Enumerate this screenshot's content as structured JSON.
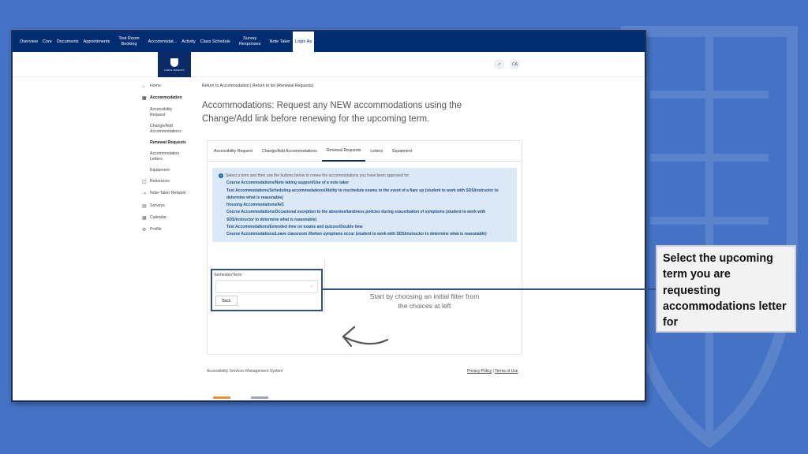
{
  "topnav": {
    "items": [
      "Overview",
      "Core",
      "Documents",
      "Appointments",
      "Test Room\nBooking",
      "Accommodat...",
      "Activity",
      "Class Schedule",
      "Survey\nResponses",
      "Note Taker",
      "Login As"
    ]
  },
  "header": {
    "logo_text": "JOHNS HOPKINS",
    "external_icon": "↗",
    "avatar": "CA"
  },
  "sidebar": {
    "home": "Home",
    "accommodation": "Accommodation",
    "subitems": [
      "Accessibility\nRequest",
      "Change/Add\nAccommodations",
      "Renewal Requests",
      "Accommodation\nLetters",
      "Equipment"
    ],
    "resources": "Resources",
    "note_taker_network": "Note-Taker Network",
    "surveys": "Surveys",
    "calendar": "Calendar",
    "profile": "Profile"
  },
  "main": {
    "breadcrumb": "Return to Accommodation | Return to list (Renewal Requests)",
    "title": "Accommodations: Request any NEW accommodations using the Change/Add link before renewing for the upcoming term.",
    "tabs": [
      "Accessibility Request",
      "Change/Add Accommodations",
      "Renewal Requests",
      "Letters",
      "Equipment"
    ],
    "info_lead": "Select a term and then use the buttons below to renew the accommodations you have been approved for:",
    "info_items": [
      "Course Accommodations/Note taking support/Use of a note taker",
      "Test Accommodations/Scheduling accommodations/Ability to reschedule exams in the event of a flare up (student to work with SDS/instructor to determine what is reasonable)",
      "Housing Accommodations/A/C",
      "Course Accommodations/Occasional exception to the absentee/tardiness policies during exacerbation of symptoms (student to work with SDS/instructor to determine what is reasonable)",
      "Test Accommodations/Extended time on exams and quizzes/Double time",
      "Course Accommodations/Leave classroom if/when symptoms occur (student to work with SDS/instructor to determine what is reasonable)"
    ],
    "semester_label": "Semester/Term",
    "back_label": "Back",
    "hint": "Start by choosing an initial filter from the choices at left"
  },
  "footer": {
    "system": "Accessibility Services Management System",
    "privacy": "Privacy Policy",
    "sep": " | ",
    "terms": "Terms of Use"
  },
  "callout": {
    "text": "Select the upcoming term you are requesting accommodations letter for"
  },
  "colors": {
    "slide_bg": "#4472c4",
    "nav_bg": "#002d72",
    "info_bg": "#dbe9f7",
    "highlight_border": "#2f4f8a"
  }
}
